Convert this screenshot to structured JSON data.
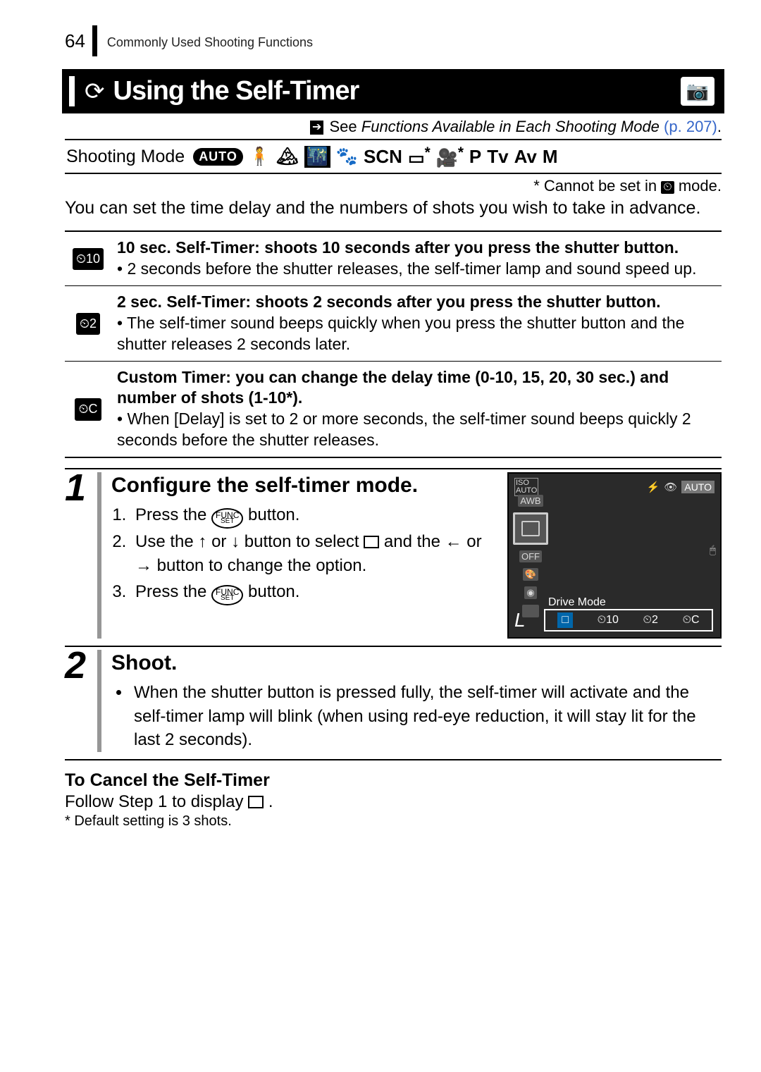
{
  "header": {
    "page_number": "64",
    "breadcrumb": "Commonly Used Shooting Functions"
  },
  "section": {
    "title": "Using the Self-Timer",
    "see_prefix": "See ",
    "see_italic": "Functions Available in Each Shooting Mode",
    "see_page": "(p. 207)",
    "see_dot": "."
  },
  "mode_row": {
    "label": "Shooting Mode",
    "auto": "AUTO",
    "scn": "SCN",
    "asterisk1": "*",
    "asterisk2": "*",
    "p": "P",
    "tv": "Tv",
    "av": "Av",
    "m": "M"
  },
  "star_note": {
    "prefix": "* Cannot be set in ",
    "suffix": " mode."
  },
  "intro": "You can set the time delay and the numbers of shots you wish to take in advance.",
  "timer_modes": [
    {
      "icon": "⏲10",
      "title": "10 sec. Self-Timer: shoots 10 seconds after you press the shutter button.",
      "bullet": "2 seconds before the shutter releases, the self-timer lamp and sound speed up."
    },
    {
      "icon": "⏲2",
      "title": "2 sec. Self-Timer: shoots 2 seconds after you press the shutter button.",
      "bullet": "The self-timer sound beeps quickly when you press the shutter button and the shutter releases 2 seconds later."
    },
    {
      "icon": "⏲C",
      "title": "Custom Timer: you can change the delay time (0-10, 15, 20, 30 sec.) and number of shots (1-10*).",
      "bullet": "When [Delay] is set to 2 or more seconds, the self-timer sound beeps quickly 2 seconds before the shutter releases."
    }
  ],
  "steps": [
    {
      "num": "1",
      "title": "Configure the self-timer mode.",
      "sub1_a": "Press the ",
      "sub1_b": " button.",
      "sub2_a": "Use the ",
      "sub2_b": " or ",
      "sub2_c": " button to select ",
      "sub2_d": " and the ",
      "sub2_e": " or ",
      "sub2_f": " button to change the option.",
      "sub3_a": "Press the ",
      "sub3_b": " button."
    },
    {
      "num": "2",
      "title": "Shoot.",
      "bullet": "When the shutter button is pressed fully, the self-timer will activate and the self-timer lamp will blink (when using red-eye reduction, it will stay lit for the last 2 seconds)."
    }
  ],
  "lcd": {
    "iso": "ISO\nAUTO",
    "awb": "AWB",
    "off": "OFF",
    "drive": "Drive Mode",
    "opt1": "□",
    "opt2": "⏲10",
    "opt3": "⏲2",
    "opt4": "⏲C",
    "auto": "AUTO"
  },
  "cancel": {
    "heading": "To Cancel the Self-Timer",
    "line_a": "Follow Step 1 to display ",
    "line_b": ".",
    "footnote": "*  Default setting is 3 shots."
  },
  "func_label_top": "FUNC",
  "func_label_bot": "SET"
}
